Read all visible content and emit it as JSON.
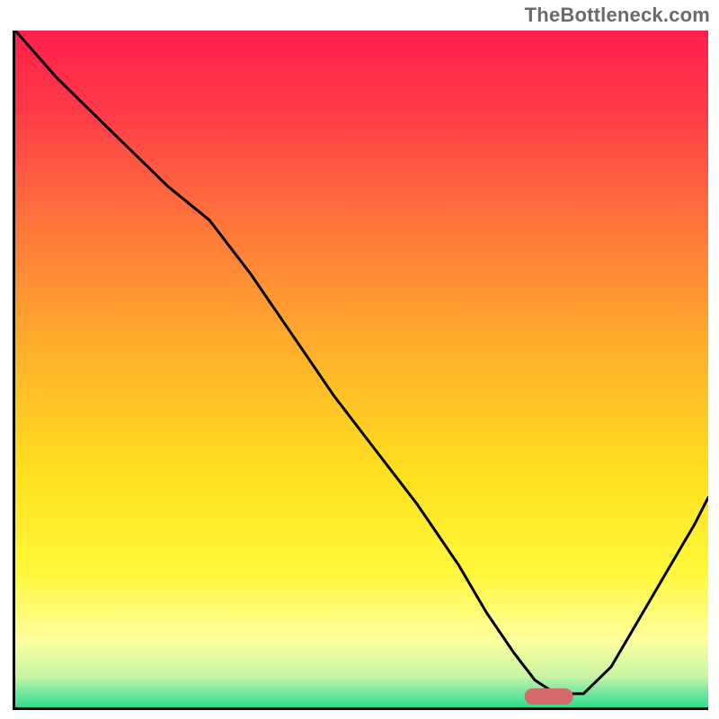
{
  "watermark": "TheBottleneck.com",
  "chart_data": {
    "type": "line",
    "title": "",
    "xlabel": "",
    "ylabel": "",
    "xlim": [
      0,
      100
    ],
    "ylim": [
      0,
      100
    ],
    "background": {
      "gradient_stops": [
        {
          "offset": 0.0,
          "color": "#ff1f4a"
        },
        {
          "offset": 0.12,
          "color": "#ff3b48"
        },
        {
          "offset": 0.3,
          "color": "#ff7a3a"
        },
        {
          "offset": 0.48,
          "color": "#ffb22a"
        },
        {
          "offset": 0.66,
          "color": "#ffe11f"
        },
        {
          "offset": 0.8,
          "color": "#fff83a"
        },
        {
          "offset": 0.9,
          "color": "#ffff9e"
        },
        {
          "offset": 0.955,
          "color": "#c7f5a4"
        },
        {
          "offset": 0.975,
          "color": "#7fe9a0"
        },
        {
          "offset": 1.0,
          "color": "#2fdf8f"
        }
      ]
    },
    "series": [
      {
        "name": "bottleneck-curve",
        "color": "#000000",
        "width": 3,
        "x": [
          0,
          6,
          14,
          22,
          28,
          34,
          40,
          46,
          52,
          58,
          64,
          68,
          72,
          75,
          78,
          82,
          86,
          90,
          94,
          98,
          100
        ],
        "y": [
          100,
          93,
          85,
          77,
          72,
          64,
          55,
          46,
          38,
          30,
          21,
          14,
          8,
          4,
          2,
          2,
          6,
          13,
          20,
          27,
          31
        ]
      }
    ],
    "marker": {
      "name": "optimal-range",
      "shape": "pill",
      "color": "#d46a6a",
      "x": 77,
      "y": 1.6,
      "width": 7,
      "height": 2.4
    }
  }
}
